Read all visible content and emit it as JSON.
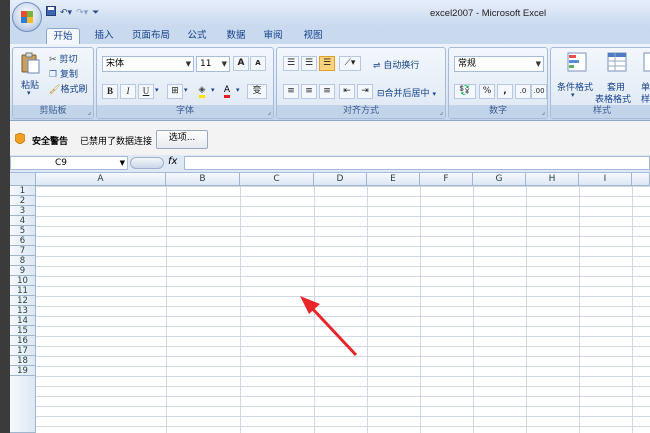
{
  "title": "excel2007 - Microsoft Excel",
  "tabs": [
    "开始",
    "插入",
    "页面布局",
    "公式",
    "数据",
    "审阅",
    "视图"
  ],
  "ribbon": {
    "clipboard": {
      "paste": "粘贴",
      "cut": "剪切",
      "copy": "复制",
      "format_painter": "格式刷",
      "label": "剪贴板"
    },
    "font": {
      "name": "宋体",
      "size": "11",
      "label": "字体",
      "bold": "B",
      "italic": "I",
      "underline": "U",
      "grow": "A",
      "shrink": "A",
      "font_color": "A",
      "phonetic": "变"
    },
    "alignment": {
      "wrap": "自动换行",
      "merge": "合并后居中",
      "label": "对齐方式"
    },
    "number": {
      "format": "常规",
      "percent": "%",
      "comma": ",",
      "label": "数字"
    },
    "styles": {
      "conditional": "条件格式",
      "table_line1": "套用",
      "table_line2": "表格格式",
      "cell_line1": "单元",
      "cell_line2": "样式",
      "label": "样式"
    }
  },
  "security": {
    "title": "安全警告",
    "message": "已禁用了数据连接",
    "options": "选项..."
  },
  "formula_bar": {
    "cell_ref": "C9",
    "fx": "fx",
    "value": ""
  },
  "columns": [
    "A",
    "B",
    "C",
    "D",
    "E",
    "F",
    "G",
    "H",
    "I"
  ],
  "rows": [
    "1",
    "2",
    "3",
    "4",
    "5",
    "6",
    "7",
    "8",
    "9",
    "10",
    "11",
    "12",
    "13",
    "14",
    "15",
    "16",
    "17",
    "18",
    "19"
  ],
  "colors": {
    "arrow": "#e8262a",
    "ribbon": "#dbe6f4",
    "header": "#dfe8f5"
  }
}
